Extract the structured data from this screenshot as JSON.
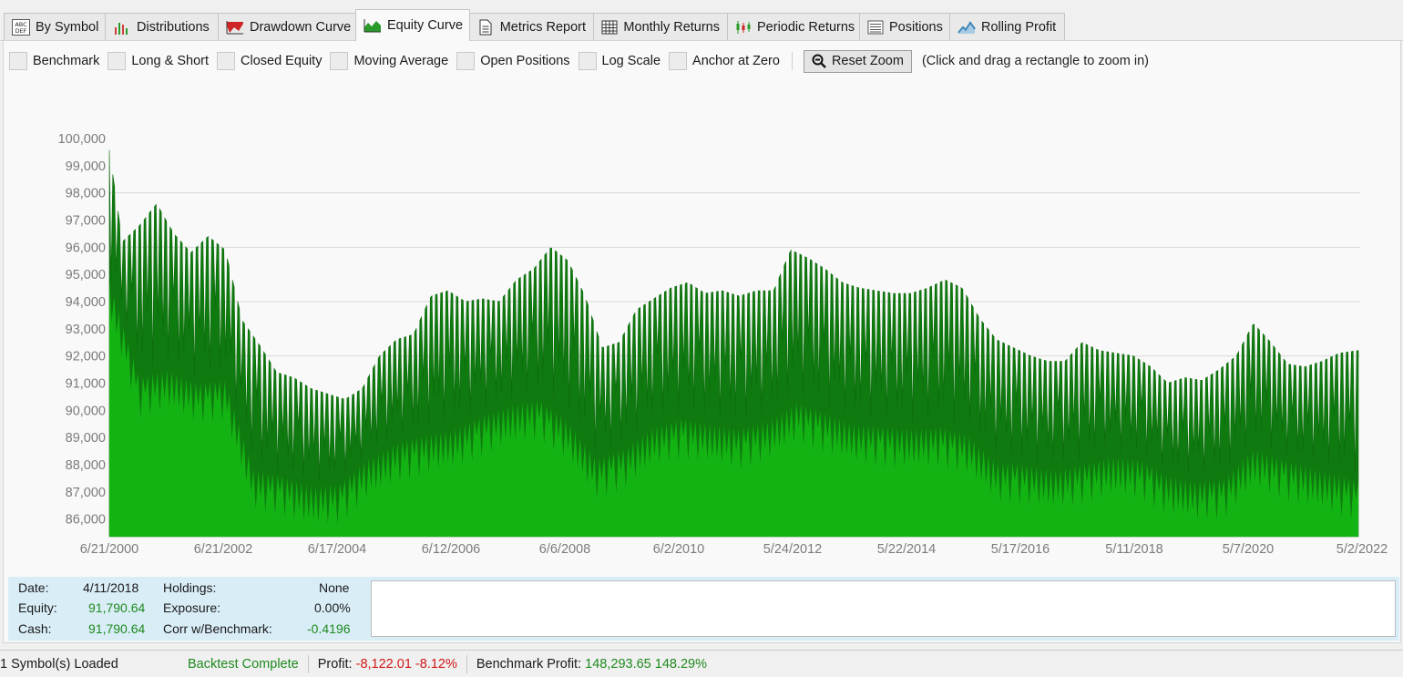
{
  "tabs": [
    {
      "label": "By Symbol",
      "icon": "abc-def-icon"
    },
    {
      "label": "Distributions",
      "icon": "bar-chart-icon"
    },
    {
      "label": "Drawdown Curve",
      "icon": "drawdown-chart-icon"
    },
    {
      "label": "Equity Curve",
      "icon": "area-chart-icon",
      "active": true
    },
    {
      "label": "Metrics Report",
      "icon": "document-icon"
    },
    {
      "label": "Monthly Returns",
      "icon": "grid-table-icon"
    },
    {
      "label": "Periodic Returns",
      "icon": "candlestick-icon"
    },
    {
      "label": "Positions",
      "icon": "list-icon"
    },
    {
      "label": "Rolling Profit",
      "icon": "mountain-chart-icon"
    }
  ],
  "toolbar": {
    "checkboxes": [
      {
        "label": "Benchmark",
        "checked": false
      },
      {
        "label": "Long & Short",
        "checked": false
      },
      {
        "label": "Closed Equity",
        "checked": false
      },
      {
        "label": "Moving Average",
        "checked": false
      },
      {
        "label": "Open Positions",
        "checked": false
      },
      {
        "label": "Log Scale",
        "checked": false
      },
      {
        "label": "Anchor at Zero",
        "checked": false
      }
    ],
    "reset_zoom_label": "Reset Zoom",
    "hint": "(Click and drag a rectangle to zoom in)"
  },
  "chart_data": {
    "type": "area",
    "title": "",
    "xlabel": "",
    "ylabel": "",
    "ylim": [
      85350,
      100000
    ],
    "y_ticks": [
      100000,
      99000,
      98000,
      97000,
      96000,
      95000,
      94000,
      93000,
      92000,
      91000,
      90000,
      89000,
      88000,
      87000,
      86000
    ],
    "y_tick_labels": [
      "100,000",
      "99,000",
      "98,000",
      "97,000",
      "96,000",
      "95,000",
      "94,000",
      "93,000",
      "92,000",
      "91,000",
      "90,000",
      "89,000",
      "88,000",
      "87,000",
      "86,000"
    ],
    "x_tick_labels": [
      "6/21/2000",
      "6/21/2002",
      "6/17/2004",
      "6/12/2006",
      "6/6/2008",
      "6/2/2010",
      "5/24/2012",
      "5/22/2014",
      "5/17/2016",
      "5/11/2018",
      "5/7/2020",
      "5/2/2022"
    ],
    "x_range": [
      "6/21/2000",
      "5/2/2022"
    ],
    "gridlines_at": [
      98000,
      96000,
      94000,
      92000
    ],
    "legend_position": "bottom-center",
    "series": [
      {
        "name": "Equity",
        "color": "#0f7a0f",
        "x": [
          2000.47,
          2000.7,
          2001.0,
          2001.3,
          2001.6,
          2001.9,
          2002.2,
          2002.5,
          2002.8,
          2003.1,
          2003.4,
          2003.7,
          2004.0,
          2004.3,
          2004.6,
          2004.9,
          2005.2,
          2005.5,
          2005.8,
          2006.1,
          2006.4,
          2006.7,
          2007.0,
          2007.3,
          2007.6,
          2007.9,
          2008.2,
          2008.5,
          2008.8,
          2009.1,
          2009.4,
          2009.7,
          2010.0,
          2010.3,
          2010.6,
          2010.9,
          2011.2,
          2011.5,
          2011.8,
          2012.1,
          2012.4,
          2012.7,
          2013.0,
          2013.3,
          2013.6,
          2013.9,
          2014.2,
          2014.5,
          2014.8,
          2015.1,
          2015.4,
          2015.7,
          2016.0,
          2016.3,
          2016.6,
          2016.9,
          2017.2,
          2017.5,
          2017.8,
          2018.1,
          2018.4,
          2018.7,
          2019.0,
          2019.3,
          2019.6,
          2019.9,
          2020.2,
          2020.5,
          2020.8,
          2021.1,
          2021.4,
          2021.7,
          2022.0,
          2022.33
        ],
        "values": [
          99600,
          96200,
          96800,
          97600,
          96500,
          95800,
          96400,
          95900,
          93300,
          92400,
          91400,
          91200,
          90800,
          90600,
          90400,
          90800,
          92000,
          92600,
          92800,
          94200,
          94400,
          94000,
          94100,
          94000,
          94800,
          95200,
          96000,
          95500,
          94200,
          92300,
          92500,
          93700,
          94100,
          94500,
          94700,
          94300,
          94400,
          94200,
          94400,
          94400,
          95900,
          95600,
          95200,
          94700,
          94500,
          94400,
          94300,
          94300,
          94500,
          94800,
          94500,
          93400,
          92600,
          92300,
          92000,
          91800,
          91800,
          92500,
          92200,
          92100,
          92000,
          91600,
          91000,
          91200,
          91100,
          91500,
          92000,
          93200,
          92500,
          91700,
          91600,
          91800,
          92100,
          92200
        ]
      },
      {
        "name": "Cash",
        "color": "#13b313",
        "x": [
          2000.47,
          2001.0,
          2001.5,
          2002.0,
          2002.5,
          2003.0,
          2003.5,
          2004.0,
          2004.5,
          2005.0,
          2005.5,
          2006.0,
          2006.5,
          2007.0,
          2007.5,
          2008.0,
          2008.5,
          2009.0,
          2009.5,
          2010.0,
          2010.5,
          2011.0,
          2011.5,
          2012.0,
          2012.5,
          2013.0,
          2013.5,
          2014.0,
          2014.5,
          2015.0,
          2015.5,
          2016.0,
          2016.5,
          2017.0,
          2017.5,
          2018.0,
          2018.5,
          2019.0,
          2019.5,
          2020.0,
          2020.5,
          2021.0,
          2021.5,
          2022.0,
          2022.33
        ],
        "values": [
          94800,
          91200,
          91500,
          91000,
          91100,
          87800,
          87600,
          87200,
          87300,
          88200,
          88800,
          89100,
          89300,
          89800,
          90200,
          90400,
          89600,
          88200,
          88600,
          89400,
          89700,
          89500,
          89300,
          89600,
          90300,
          89900,
          89500,
          89400,
          89300,
          89400,
          89100,
          88100,
          88000,
          87800,
          88000,
          88300,
          88200,
          87600,
          87400,
          87500,
          88600,
          88200,
          87900,
          87600,
          87400
        ]
      }
    ]
  },
  "info": {
    "date_label": "Date:",
    "date_value": "4/11/2018",
    "equity_label": "Equity:",
    "equity_value": "91,790.64",
    "cash_label": "Cash:",
    "cash_value": "91,790.64",
    "holdings_label": "Holdings:",
    "holdings_value": "None",
    "exposure_label": "Exposure:",
    "exposure_value": "0.00%",
    "corr_label": "Corr w/Benchmark:",
    "corr_value": "-0.4196"
  },
  "status": {
    "symbols_loaded": "1 Symbol(s) Loaded",
    "backtest_state": "Backtest Complete",
    "profit_label": "Profit:",
    "profit_value": "-8,122.01",
    "profit_pct": "-8.12%",
    "benchmark_label": "Benchmark Profit:",
    "benchmark_value": "148,293.65",
    "benchmark_pct": "148.29%"
  },
  "colors": {
    "equity": "#0f7a0f",
    "cash": "#13b313",
    "positive": "#1e8a1e",
    "negative": "#d01717",
    "info_background": "#d9edf7"
  }
}
